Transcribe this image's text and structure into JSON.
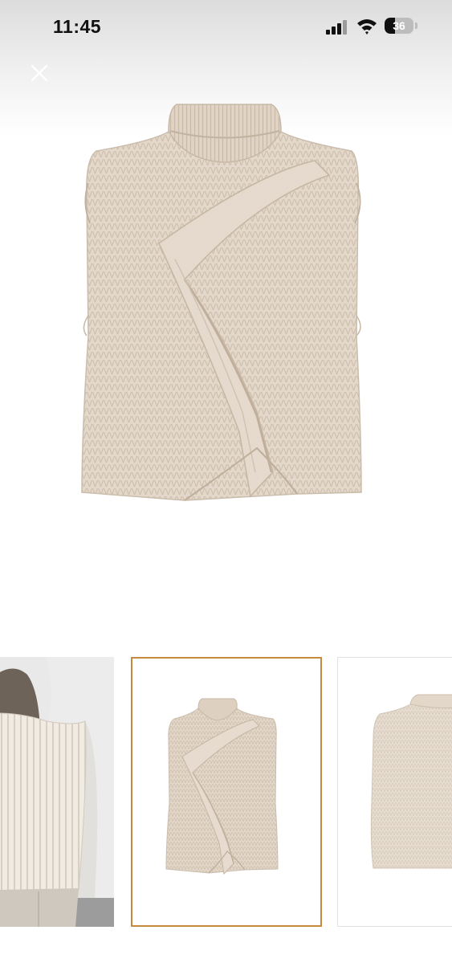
{
  "status_bar": {
    "time": "11:45",
    "battery_level": "36",
    "battery_fraction": 0.36,
    "icons": [
      "signal-icon",
      "wifi-icon",
      "battery-icon"
    ]
  },
  "viewer": {
    "close_icon": "close-icon",
    "main_image": "knit-vest-front-image",
    "thumbnails": [
      {
        "image": "model-wearing-vest-back-view",
        "selected": false
      },
      {
        "image": "knit-vest-front-view",
        "selected": true
      },
      {
        "image": "knit-vest-back-view",
        "selected": false
      }
    ]
  },
  "colors": {
    "knit": "#e3d7c9",
    "selected_border": "#c68a3e",
    "background": "#ffffff"
  }
}
